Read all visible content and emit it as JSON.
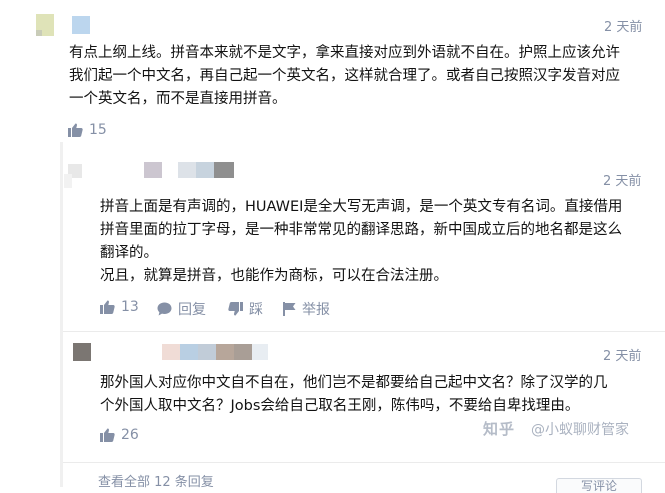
{
  "comment_main": {
    "time": "2 天前",
    "lines": [
      "有点上纲上线。拼音本来就不是文字，拿来直接对应到外语就不自在。护照上应该允许",
      "我们起一个中文名，再自己起一个英文名，这样就合理了。或者自己按照汉字发音对应",
      "一个英文名，而不是直接用拼音。"
    ],
    "like_count": "15"
  },
  "reply_1": {
    "time": "2 天前",
    "lines": [
      "拼音上面是有声调的，HUAWEI是全大写无声调，是一个英文专有名词。直接借用",
      "拼音里面的拉丁字母，是一种非常常见的翻译思路，新中国成立后的地名都是这么",
      "翻译的。",
      "况且，就算是拼音，也能作为商标，可以在合法注册。"
    ],
    "like_count": "13",
    "reply_label": "回复",
    "dislike_label": "踩",
    "report_label": "举报"
  },
  "reply_2": {
    "time": "2 天前",
    "lines": [
      "那外国人对应你中文自不自在，他们岂不是都要给自己起中文名？除了汉学的几",
      "个外国人取中文名？Jobs会给自己取名王刚，陈伟吗，不要给自卑找理由。"
    ],
    "like_count": "26"
  },
  "view_all": "查看全部 12 条回复",
  "watermark": {
    "logo": "知乎",
    "text": "@小蚁聊财管家"
  },
  "write_comment": "写评论",
  "icons": {
    "like": "thumbs-up-icon",
    "reply": "reply-icon",
    "dislike": "thumbs-down-icon",
    "report": "flag-icon"
  },
  "colors": {
    "meta_gray": "#8590a6",
    "text": "#121212",
    "avatar_yellow": "#dfe3b8",
    "avatar_blue": "#bcd6ee"
  }
}
